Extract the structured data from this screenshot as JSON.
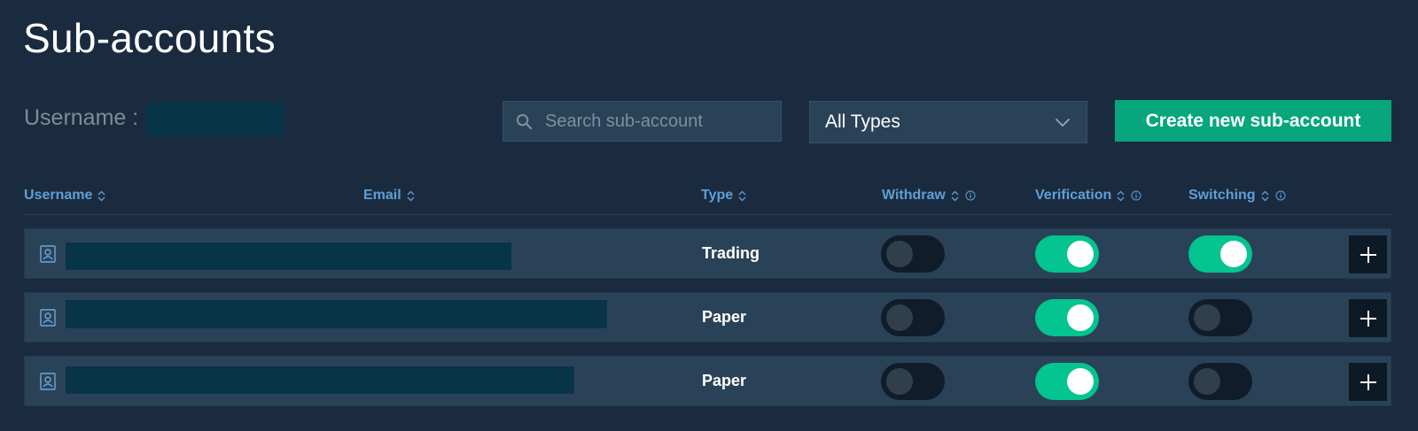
{
  "page": {
    "title": "Sub-accounts"
  },
  "filters": {
    "username_label": "Username :",
    "search_placeholder": "Search sub-account",
    "type_select_value": "All Types",
    "create_button_label": "Create new sub-account"
  },
  "table": {
    "columns": {
      "username": "Username",
      "email": "Email",
      "type": "Type",
      "withdraw": "Withdraw",
      "verification": "Verification",
      "switching": "Switching"
    },
    "rows": [
      {
        "type": "Trading",
        "withdraw": false,
        "verification": true,
        "switching": true
      },
      {
        "type": "Paper",
        "withdraw": false,
        "verification": true,
        "switching": false
      },
      {
        "type": "Paper",
        "withdraw": false,
        "verification": true,
        "switching": false
      }
    ]
  },
  "colors": {
    "background": "#1b2b3f",
    "accent": "#07a67c",
    "toggle_on": "#04c48f",
    "header_text": "#5e9fd6",
    "redaction": "#083448"
  },
  "icons": [
    "search-icon",
    "chevron-down-icon",
    "sort-icon",
    "info-icon",
    "user-icon",
    "plus-icon"
  ]
}
